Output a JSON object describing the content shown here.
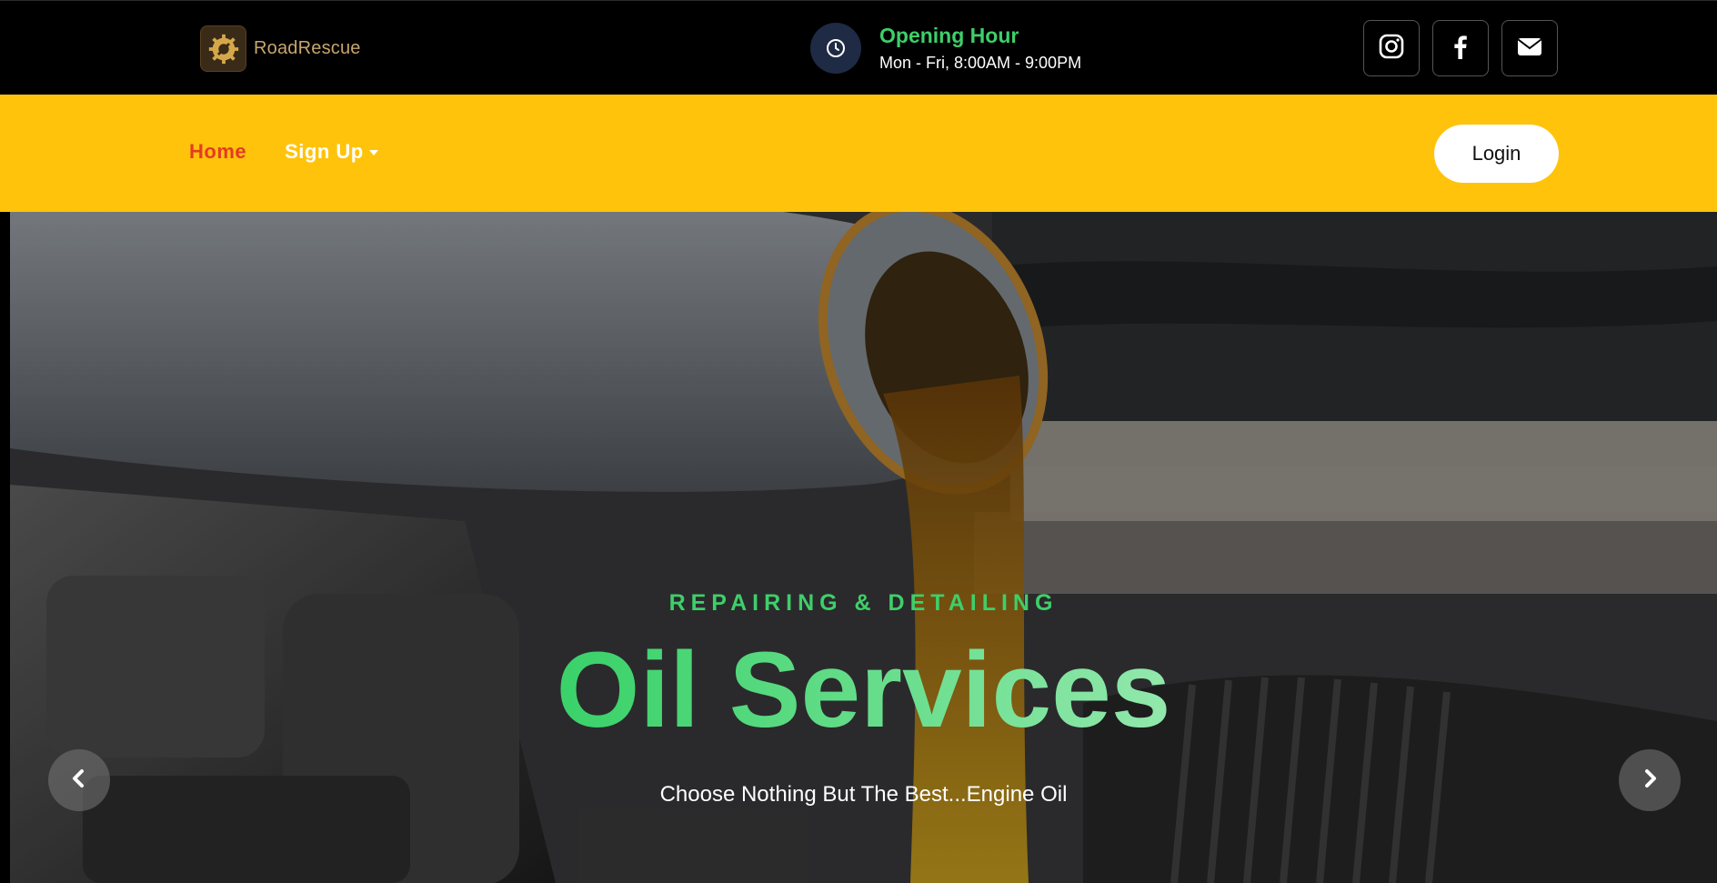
{
  "brand": {
    "name": "RoadRescue",
    "logo_icon": "gear-wrench-icon"
  },
  "opening": {
    "title": "Opening Hour",
    "hours": "Mon - Fri, 8:00AM - 9:00PM",
    "icon": "clock-icon"
  },
  "socials": [
    {
      "name": "instagram",
      "icon": "instagram-icon"
    },
    {
      "name": "facebook",
      "icon": "facebook-icon"
    },
    {
      "name": "email",
      "icon": "envelope-icon"
    }
  ],
  "nav": {
    "home_label": "Home",
    "signup_label": "Sign Up",
    "login_label": "Login"
  },
  "hero": {
    "kicker": "REPAIRING & DETAILING",
    "title": "Oil Services",
    "subtitle": "Choose Nothing But The Best...Engine Oil",
    "prev_icon": "chevron-left-icon",
    "next_icon": "chevron-right-icon"
  },
  "colors": {
    "topbar_bg": "#000000",
    "navbar_bg": "#ffc30b",
    "accent_green": "#3ecf6a",
    "active_link": "#e53a26",
    "brand_gold": "#c8a66b"
  }
}
